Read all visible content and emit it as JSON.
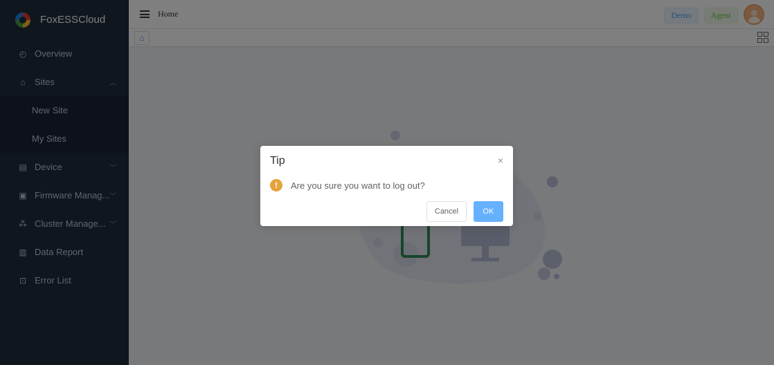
{
  "app": {
    "name": "FoxESSCloud"
  },
  "sidebar": {
    "items": [
      {
        "label": "Overview",
        "icon": "gauge-icon"
      },
      {
        "label": "Sites",
        "icon": "home-icon",
        "expanded": true
      },
      {
        "label": "Device",
        "icon": "device-icon"
      },
      {
        "label": "Firmware Manag...",
        "icon": "firmware-icon"
      },
      {
        "label": "Cluster Manage...",
        "icon": "cluster-icon"
      },
      {
        "label": "Data Report",
        "icon": "chart-icon"
      },
      {
        "label": "Error List",
        "icon": "error-icon"
      }
    ],
    "sites_children": [
      {
        "label": "New Site"
      },
      {
        "label": "My Sites"
      }
    ]
  },
  "header": {
    "breadcrumb": "Home",
    "badges": {
      "demo": "Demo",
      "agent": "Agent"
    }
  },
  "dialog": {
    "title": "Tip",
    "close_glyph": "×",
    "warn_glyph": "!",
    "message": "Are you sure you want to log out?",
    "cancel_label": "Cancel",
    "ok_label": "OK"
  },
  "colors": {
    "sidebar_bg": "#1f2d3d",
    "primary": "#409eff",
    "ok_button": "#66b1ff",
    "warning": "#e6a23c",
    "success": "#67c23a"
  }
}
